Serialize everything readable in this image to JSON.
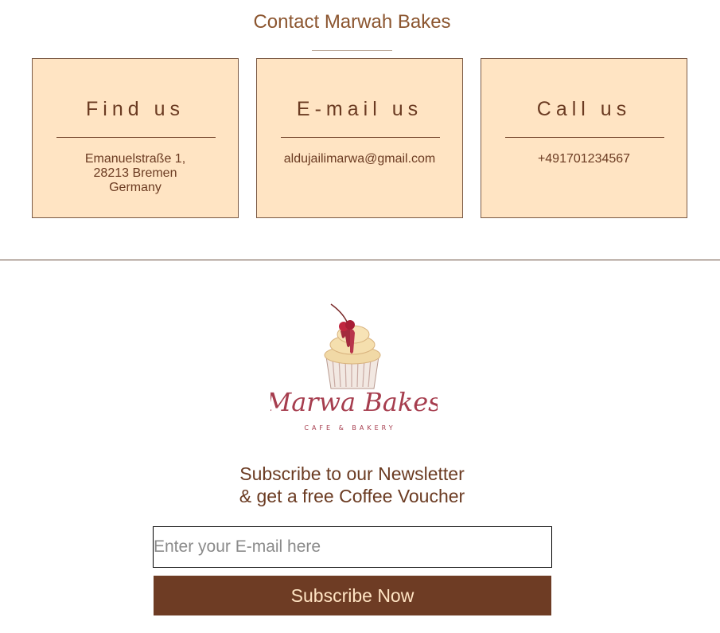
{
  "contact": {
    "title": "Contact Marwah Bakes",
    "cards": [
      {
        "heading": "Find us",
        "lines": [
          "Emanuelstraße 1,",
          "28213 Bremen",
          "Germany"
        ]
      },
      {
        "heading": "E-mail us",
        "lines": [
          "aldujailimarwa@gmail.com"
        ]
      },
      {
        "heading": "Call us",
        "lines": [
          "+491701234567"
        ]
      }
    ]
  },
  "logo": {
    "name": "Marwa Bakes",
    "tagline": "CAFE & BAKERY"
  },
  "newsletter": {
    "line1": "Subscribe to our Newsletter",
    "line2": "& get a free Coffee Voucher",
    "email_placeholder": "Enter your E-mail here",
    "button_label": "Subscribe Now"
  },
  "colors": {
    "card_background": "#ffe4c3",
    "text_brown": "#6b3b22",
    "button_background": "#6e3c24",
    "button_text": "#ffe4c3",
    "logo_text": "#a63d4e"
  }
}
